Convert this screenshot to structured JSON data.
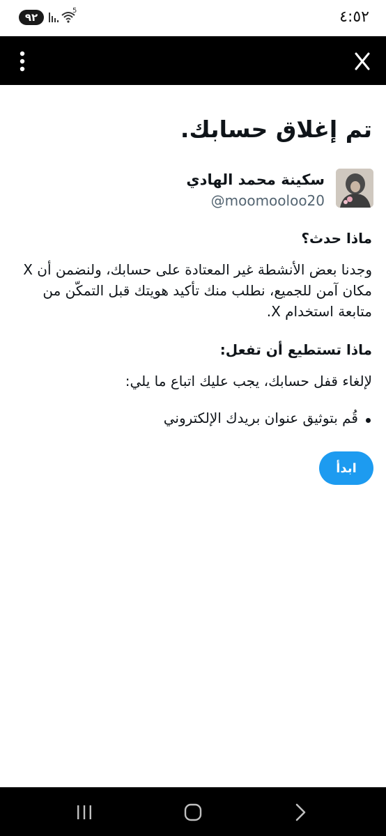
{
  "status_bar": {
    "time": "٤:٥٢",
    "battery": "٩٢",
    "signal_label": "5"
  },
  "page": {
    "title": "تم إغلاق حسابك.",
    "user": {
      "name": "سكينة محمد الهادي",
      "handle": "@moomooloo20"
    },
    "what_happened": {
      "heading": "ماذا حدث؟",
      "line1": "وجدنا بعض الأنشطة غير المعتادة على حسابك، ولنضمن أن X",
      "line2": "مكان آمن للجميع، نطلب منك تأكيد هويتك قبل التمكّن من",
      "line3": "متابعة استخدام X."
    },
    "what_to_do": {
      "heading": "ماذا تستطيع أن تفعل:",
      "body": "لإلغاء قفل حسابك، يجب عليك اتباع ما يلي:",
      "steps": [
        "قُم بتوثيق عنوان بريدك الإلكتروني"
      ]
    },
    "start_label": "ابدأ"
  },
  "icons": {
    "menu": "vertical-ellipsis-icon",
    "close": "close-icon",
    "recents": "recents-icon",
    "home": "home-icon",
    "back": "back-icon"
  },
  "colors": {
    "accent": "#1d9bf0",
    "top_bar": "#000000",
    "text": "#0f1419",
    "muted": "#536471"
  }
}
